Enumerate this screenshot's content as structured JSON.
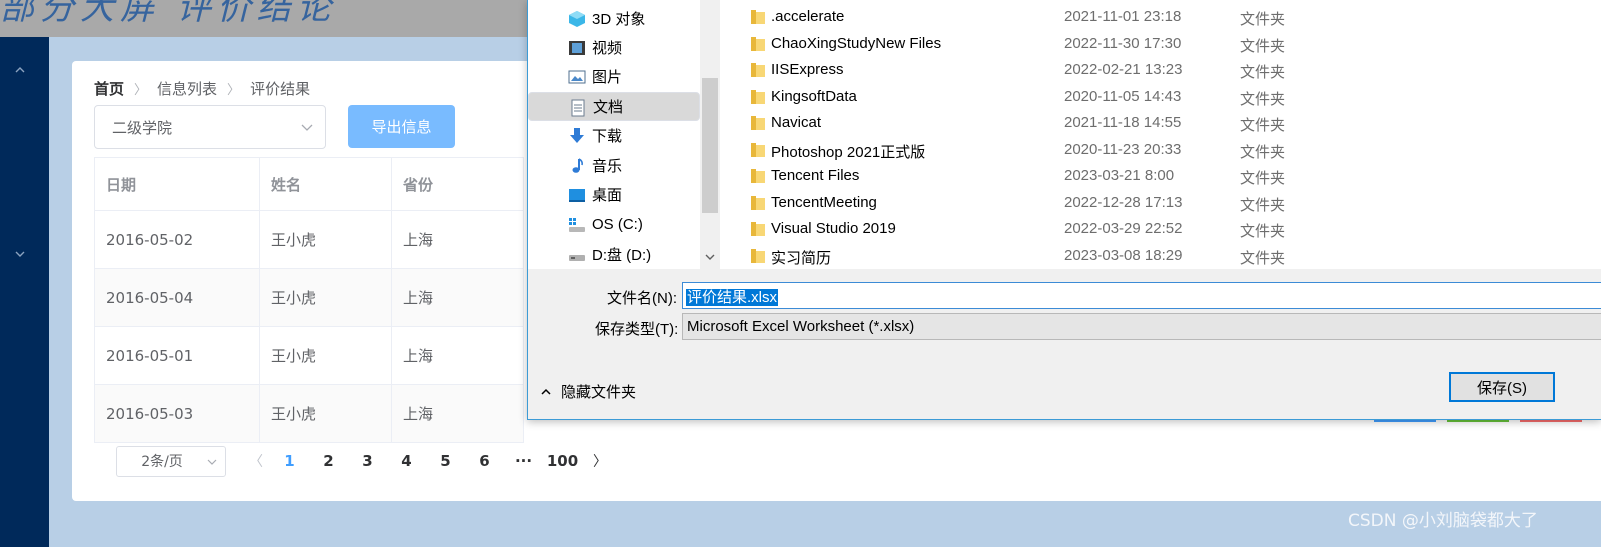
{
  "banner": {
    "title_fragment": "部分大屏 评价结论"
  },
  "breadcrumb": {
    "home": "首页",
    "item2": "信息列表",
    "item3": "评价结果"
  },
  "filter": {
    "college_select": "二级学院",
    "export_button": "导出信息"
  },
  "table": {
    "headers": [
      "日期",
      "姓名",
      "省份"
    ],
    "rows": [
      [
        "2016-05-02",
        "王小虎",
        "上海"
      ],
      [
        "2016-05-04",
        "王小虎",
        "上海"
      ],
      [
        "2016-05-01",
        "王小虎",
        "上海"
      ],
      [
        "2016-05-03",
        "王小虎",
        "上海"
      ]
    ]
  },
  "pagination": {
    "page_size": "2条/页",
    "pages": [
      "1",
      "2",
      "3",
      "4",
      "5",
      "6"
    ],
    "ellipsis": "···",
    "last_page": "100",
    "current": "1"
  },
  "dialog": {
    "nav_items": [
      {
        "label": "3D 对象",
        "icon": "3d-objects-icon"
      },
      {
        "label": "视频",
        "icon": "video-icon"
      },
      {
        "label": "图片",
        "icon": "pictures-icon"
      },
      {
        "label": "文档",
        "icon": "documents-icon"
      },
      {
        "label": "下载",
        "icon": "downloads-icon"
      },
      {
        "label": "音乐",
        "icon": "music-icon"
      },
      {
        "label": "桌面",
        "icon": "desktop-icon"
      },
      {
        "label": "OS (C:)",
        "icon": "drive-icon"
      },
      {
        "label": "D:盘 (D:)",
        "icon": "drive-icon"
      }
    ],
    "selected_nav": "文档",
    "files": [
      {
        "name": ".accelerate",
        "date": "2021-11-01 23:18",
        "type": "文件夹"
      },
      {
        "name": "ChaoXingStudyNew Files",
        "date": "2022-11-30 17:30",
        "type": "文件夹"
      },
      {
        "name": "IISExpress",
        "date": "2022-02-21 13:23",
        "type": "文件夹"
      },
      {
        "name": "KingsoftData",
        "date": "2020-11-05 14:43",
        "type": "文件夹"
      },
      {
        "name": "Navicat",
        "date": "2021-11-18 14:55",
        "type": "文件夹"
      },
      {
        "name": "Photoshop 2021正式版",
        "date": "2020-11-23 20:33",
        "type": "文件夹"
      },
      {
        "name": "Tencent Files",
        "date": "2023-03-21 8:00",
        "type": "文件夹"
      },
      {
        "name": "TencentMeeting",
        "date": "2022-12-28 17:13",
        "type": "文件夹"
      },
      {
        "name": "Visual Studio 2019",
        "date": "2022-03-29 22:52",
        "type": "文件夹"
      },
      {
        "name": "实习简历",
        "date": "2023-03-08 18:29",
        "type": "文件夹"
      }
    ],
    "filename_label": "文件名(N):",
    "filename_value": "评价结果.xlsx",
    "filetype_label": "保存类型(T):",
    "filetype_value": "Microsoft Excel Worksheet (*.xlsx)",
    "hide_folders": "隐藏文件夹",
    "save_button": "保存(S)"
  },
  "watermark": "CSDN @小刘脑袋都大了",
  "colors": {
    "sidebar": "#00295a",
    "page_bg": "#b8cfe6",
    "primary": "#409eff",
    "export_btn": "#79bbff",
    "dialog_border": "#3c9bd6",
    "selection": "#0078d7"
  }
}
